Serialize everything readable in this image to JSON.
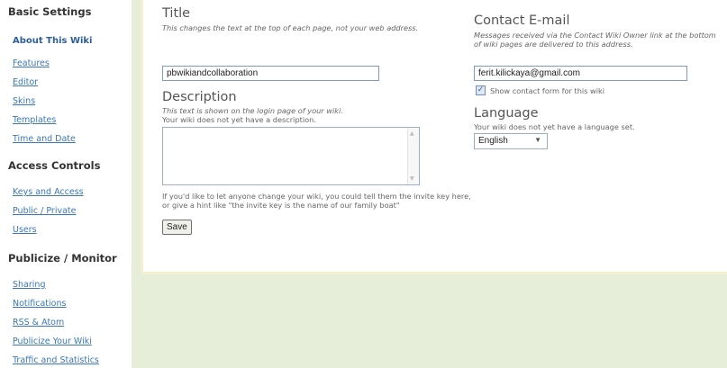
{
  "sidebar": {
    "sections": [
      {
        "title": "Basic Settings",
        "items": [
          {
            "label": "About This Wiki",
            "active": true
          },
          {
            "label": "Features"
          },
          {
            "label": "Editor"
          },
          {
            "label": "Skins"
          },
          {
            "label": "Templates"
          },
          {
            "label": "Time and Date"
          }
        ]
      },
      {
        "title": "Access Controls",
        "items": [
          {
            "label": "Keys and Access"
          },
          {
            "label": "Public / Private"
          },
          {
            "label": "Users"
          }
        ]
      },
      {
        "title": "Publicize / Monitor",
        "items": [
          {
            "label": "Sharing"
          },
          {
            "label": "Notifications"
          },
          {
            "label": "RSS & Atom"
          },
          {
            "label": "Publicize Your Wiki"
          },
          {
            "label": "Traffic and Statistics"
          }
        ]
      }
    ]
  },
  "form": {
    "title": {
      "heading": "Title",
      "hint": "This changes the text at the top of each page, not your web address.",
      "value": "pbwikiandcollaboration"
    },
    "description": {
      "heading": "Description",
      "hint": "This text is shown on the login page of your wiki.",
      "status": "Your wiki does not yet have a description.",
      "help": "If you'd like to let anyone change your wiki, you could tell them the invite key here, or give a hint like \"the invite key is the name of our family boat\"",
      "value": ""
    },
    "contact": {
      "heading": "Contact E-mail",
      "hint": "Messages received via the Contact Wiki Owner link at the bottom of wiki pages are delivered to this address.",
      "value": "ferit.kilickaya@gmail.com",
      "checkbox_label": "Show contact form for this wiki",
      "checked": true
    },
    "language": {
      "heading": "Language",
      "status": "Your wiki does not yet have a language set.",
      "selected": "English"
    },
    "save_label": "Save"
  },
  "colors": {
    "page_background": "#e6eed9",
    "link": "#3a78b8",
    "card_border": "#f3f0cf"
  }
}
